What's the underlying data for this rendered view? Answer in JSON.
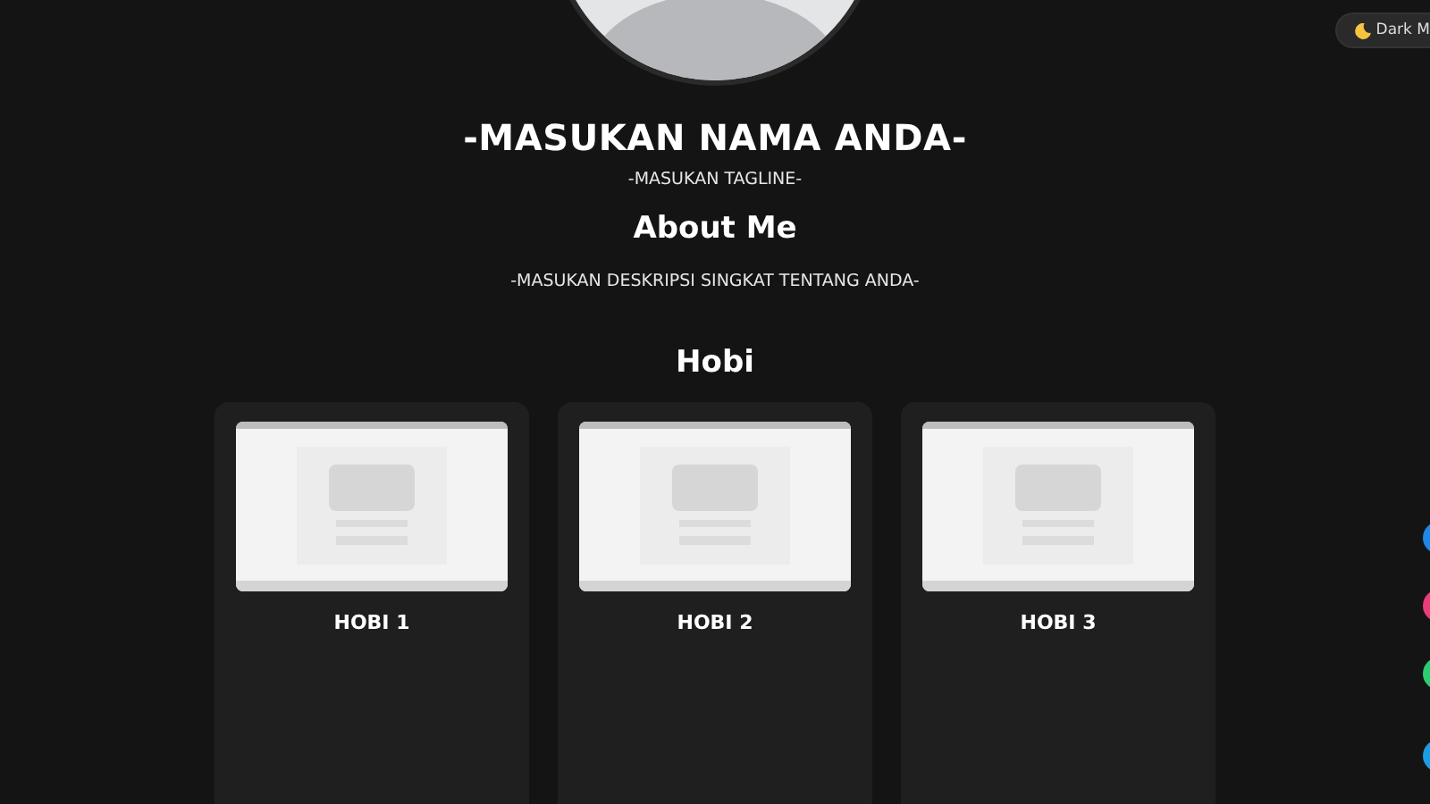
{
  "theme_toggle": {
    "label": "Dark M"
  },
  "profile": {
    "name": "-MASUKAN NAMA ANDA-",
    "tagline": "-MASUKAN TAGLINE-"
  },
  "about": {
    "heading": "About Me",
    "text": "-MASUKAN DESKRIPSI SINGKAT TENTANG ANDA-"
  },
  "hobbies": {
    "heading": "Hobi",
    "items": [
      {
        "title": "HOBI 1"
      },
      {
        "title": "HOBI 2"
      },
      {
        "title": "HOBI 3"
      }
    ]
  },
  "social_buttons": [
    {
      "color": "#1e88e5"
    },
    {
      "color": "#e83e7a"
    },
    {
      "color": "#2ecc71"
    },
    {
      "color": "#1e9be5"
    }
  ]
}
